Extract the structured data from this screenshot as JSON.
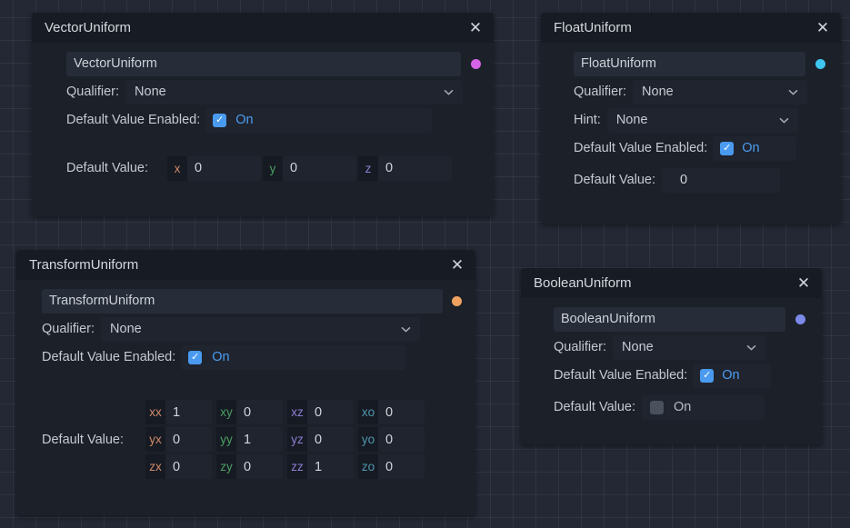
{
  "app": {
    "background_color": "#232834",
    "grid_color": "#2e3440",
    "editor": "visual-shader-graph"
  },
  "common": {
    "qualifier_label": "Qualifier:",
    "hint_label": "Hint:",
    "default_value_enabled_label": "Default Value Enabled:",
    "default_value_label": "Default Value:",
    "none_option": "None",
    "on_label": "On",
    "close_icon": "close-icon",
    "chevron_icon": "chevron-down-icon",
    "checkbox_checked_color": "#4a9bf0",
    "checkbox_unchecked_color": "#4a505c",
    "on_text_color": "#4d9df2"
  },
  "nodes": [
    {
      "id": "vector-uniform",
      "title": "VectorUniform",
      "name_value": "VectorUniform",
      "port_color": "#d664e8",
      "qualifier": "None",
      "default_value_enabled": true,
      "default_value_enabled_text": "On",
      "components": [
        {
          "key": "x",
          "value": "0",
          "color": "#d08a6c"
        },
        {
          "key": "y",
          "value": "0",
          "color": "#4b9f63"
        },
        {
          "key": "z",
          "value": "0",
          "color": "#8e7ed6"
        }
      ]
    },
    {
      "id": "float-uniform",
      "title": "FloatUniform",
      "name_value": "FloatUniform",
      "port_color": "#3ec6ef",
      "qualifier": "None",
      "hint": "None",
      "default_value_enabled": true,
      "default_value_enabled_text": "On",
      "default_value": "0"
    },
    {
      "id": "transform-uniform",
      "title": "TransformUniform",
      "name_value": "TransformUniform",
      "port_color": "#f0a261",
      "qualifier": "None",
      "default_value_enabled": true,
      "default_value_enabled_text": "On",
      "matrix": [
        [
          {
            "key": "xx",
            "value": "1",
            "color": "#d08a6c"
          },
          {
            "key": "xy",
            "value": "0",
            "color": "#4b9f63"
          },
          {
            "key": "xz",
            "value": "0",
            "color": "#8e7ed6"
          },
          {
            "key": "xo",
            "value": "0",
            "color": "#4f95b0"
          }
        ],
        [
          {
            "key": "yx",
            "value": "0",
            "color": "#d08a6c"
          },
          {
            "key": "yy",
            "value": "1",
            "color": "#4b9f63"
          },
          {
            "key": "yz",
            "value": "0",
            "color": "#8e7ed6"
          },
          {
            "key": "yo",
            "value": "0",
            "color": "#4f95b0"
          }
        ],
        [
          {
            "key": "zx",
            "value": "0",
            "color": "#d08a6c"
          },
          {
            "key": "zy",
            "value": "0",
            "color": "#4b9f63"
          },
          {
            "key": "zz",
            "value": "1",
            "color": "#8e7ed6"
          },
          {
            "key": "zo",
            "value": "0",
            "color": "#4f95b0"
          }
        ]
      ]
    },
    {
      "id": "boolean-uniform",
      "title": "BooleanUniform",
      "name_value": "BooleanUniform",
      "port_color": "#7b8ae6",
      "qualifier": "None",
      "default_value_enabled": true,
      "default_value_enabled_text": "On",
      "default_value_checked": false,
      "default_value_text": "On"
    }
  ]
}
